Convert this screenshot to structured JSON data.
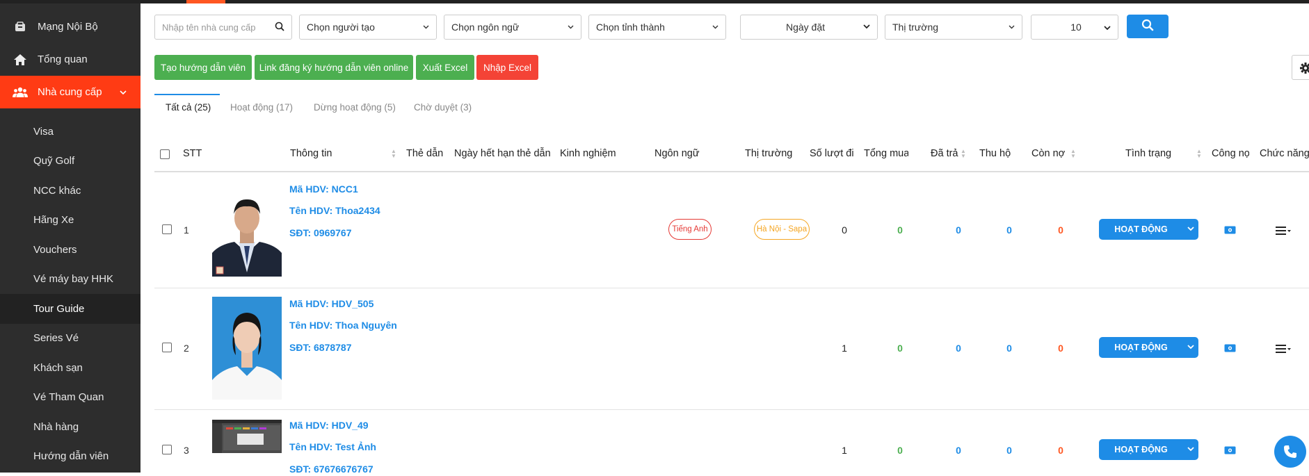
{
  "sidebar": {
    "top_items": [
      {
        "label": "Mạng Nội Bộ"
      },
      {
        "label": "Tổng quan"
      }
    ],
    "active_item": {
      "label": "Nhà cung cấp"
    },
    "sub_items": [
      {
        "label": "Visa"
      },
      {
        "label": "Quỹ Golf"
      },
      {
        "label": "NCC khác"
      },
      {
        "label": "Hãng Xe"
      },
      {
        "label": "Vouchers"
      },
      {
        "label": "Vé máy bay HHK"
      },
      {
        "label": "Tour Guide"
      },
      {
        "label": "Series Vé"
      },
      {
        "label": "Khách sạn"
      },
      {
        "label": "Vé Tham Quan"
      },
      {
        "label": "Nhà hàng"
      },
      {
        "label": "Hướng dẫn viên"
      }
    ],
    "selected_sub": "Tour Guide"
  },
  "filters": {
    "supplier_placeholder": "Nhập tên nhà cung cấp",
    "creator": "Chọn người tạo",
    "language": "Chọn ngôn ngữ",
    "province": "Chọn tỉnh thành",
    "date_sort": "Ngày đặt",
    "market": "Thị trường",
    "page_size": "10"
  },
  "actions": {
    "create": "Tạo hướng dẫn viên",
    "register_link": "Link đăng ký hướng dẫn viên online",
    "export": "Xuất Excel",
    "import": "Nhập Excel"
  },
  "tabs": [
    {
      "label": "Tất cả (25)"
    },
    {
      "label": "Hoạt động (17)"
    },
    {
      "label": "Dừng hoạt động (5)"
    },
    {
      "label": "Chờ duyệt (3)"
    }
  ],
  "table": {
    "headers": {
      "stt": "STT",
      "info": "Thông tin",
      "card": "Thẻ dẫn",
      "card_expiry": "Ngày hết hạn thẻ dẫn",
      "experience": "Kinh nghiệm",
      "language": "Ngôn ngữ",
      "market": "Thị trường",
      "trips": "Số lượt đi",
      "total_buy": "Tổng mua",
      "paid": "Đã trả",
      "collected": "Thu hộ",
      "debt": "Còn nợ",
      "status": "Tình trạng",
      "receivable": "Công nợ",
      "function": "Chức năng"
    },
    "rows": [
      {
        "stt": "1",
        "code": "Mã HDV: NCC1",
        "name": "Tên HDV: Thoa2434",
        "phone": "SĐT: 0969767",
        "language": "Tiếng Anh",
        "market": "Hà Nội - Sapa",
        "trips": "0",
        "total_buy": "0",
        "paid": "0",
        "collected": "0",
        "debt": "0",
        "status": "HOẠT ĐỘNG"
      },
      {
        "stt": "2",
        "code": "Mã HDV: HDV_505",
        "name": "Tên HDV: Thoa Nguyên",
        "phone": "SĐT: 6878787",
        "language": "",
        "market": "",
        "trips": "1",
        "total_buy": "0",
        "paid": "0",
        "collected": "0",
        "debt": "0",
        "status": "HOẠT ĐỘNG"
      },
      {
        "stt": "3",
        "code": "Mã HDV: HDV_49",
        "name": "Tên HDV: Test Ảnh",
        "phone": "SĐT: 67676676767",
        "language": "",
        "market": "",
        "trips": "1",
        "total_buy": "0",
        "paid": "0",
        "collected": "0",
        "debt": "0",
        "status": "HOẠT ĐỘNG"
      }
    ]
  },
  "colors": {
    "brand": "#ff3b14",
    "primary": "#1e8ce6",
    "green": "#4caf50",
    "red": "#f44336",
    "orange": "#f5a623"
  }
}
